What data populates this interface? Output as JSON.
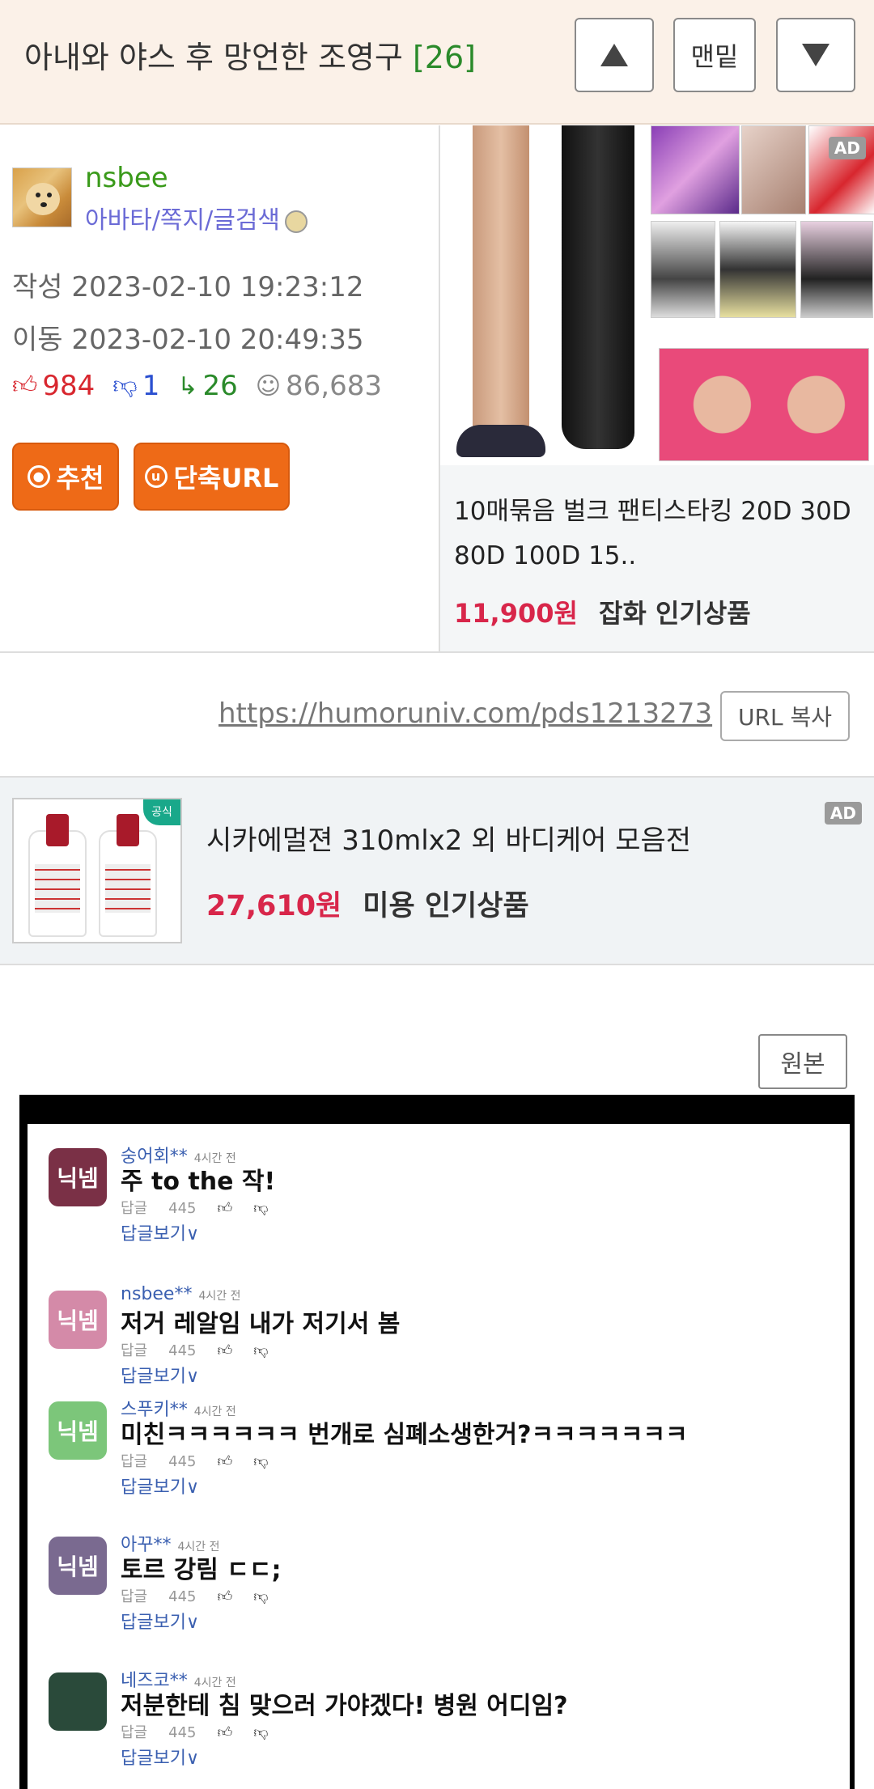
{
  "header": {
    "title": "아내와 야스 후 망언한 조영구",
    "count": "[26]",
    "up_icon": "triangle-up-icon",
    "bottom_label": "맨밑",
    "down_icon": "triangle-down-icon"
  },
  "post": {
    "username": "nsbee",
    "user_links": "아바타/쪽지/글검색",
    "written": "작성 2023-02-10 19:23:12",
    "moved": "이동 2023-02-10 20:49:35",
    "stats": {
      "up": "984",
      "down": "1",
      "replies": "26",
      "views": "86,683"
    },
    "recommend_label": "추천",
    "short_url_label": "단축URL"
  },
  "ad_right": {
    "badge": "AD",
    "name": "10매묶음 벌크 팬티스타킹 20D 30D 80D 100D 15..",
    "price": "11,900원",
    "category": "잡화 인기상품"
  },
  "url_row": {
    "url": "https://humoruniv.com/pds1213273",
    "copy_label": "URL 복사"
  },
  "ad_bottom": {
    "badge": "AD",
    "thumb_badge": "공식",
    "name": "시카에멀젼 310mlx2 외 바디케어 모음전",
    "price": "27,610원",
    "category": "미용 인기상품"
  },
  "original_label": "원본",
  "comments": [
    {
      "avatar": "닉넴",
      "nick": "숭어회**",
      "time": "4시간 전",
      "text": "주 to the 작!",
      "reply": "답글",
      "likes": "445",
      "more": "답글보기∨",
      "color": "#7a3046"
    },
    {
      "avatar": "닉넴",
      "nick": "nsbee**",
      "time": "4시간 전",
      "text": "저거 레알임 내가 저기서 봄",
      "reply": "답글",
      "likes": "445",
      "more": "답글보기∨",
      "color": "#d48aa8"
    },
    {
      "avatar": "닉넴",
      "nick": "스푸키**",
      "time": "4시간 전",
      "text": "미친ㅋㅋㅋㅋㅋㅋ 번개로 심폐소생한거?ㅋㅋㅋㅋㅋㅋㅋ",
      "reply": "답글",
      "likes": "445",
      "more": "답글보기∨",
      "color": "#7cc67a"
    },
    {
      "avatar": "닉넴",
      "nick": "아꾸**",
      "time": "4시간 전",
      "text": "토르 강림 ㄷㄷ;",
      "reply": "답글",
      "likes": "445",
      "more": "답글보기∨",
      "color": "#7a6a90"
    },
    {
      "avatar": "",
      "nick": "네즈코**",
      "time": "4시간 전",
      "text": "저분한테 침 맞으러 가야겠다! 병원 어디임?",
      "reply": "답글",
      "likes": "445",
      "more": "답글보기∨",
      "color": "#2a4a3a"
    }
  ]
}
